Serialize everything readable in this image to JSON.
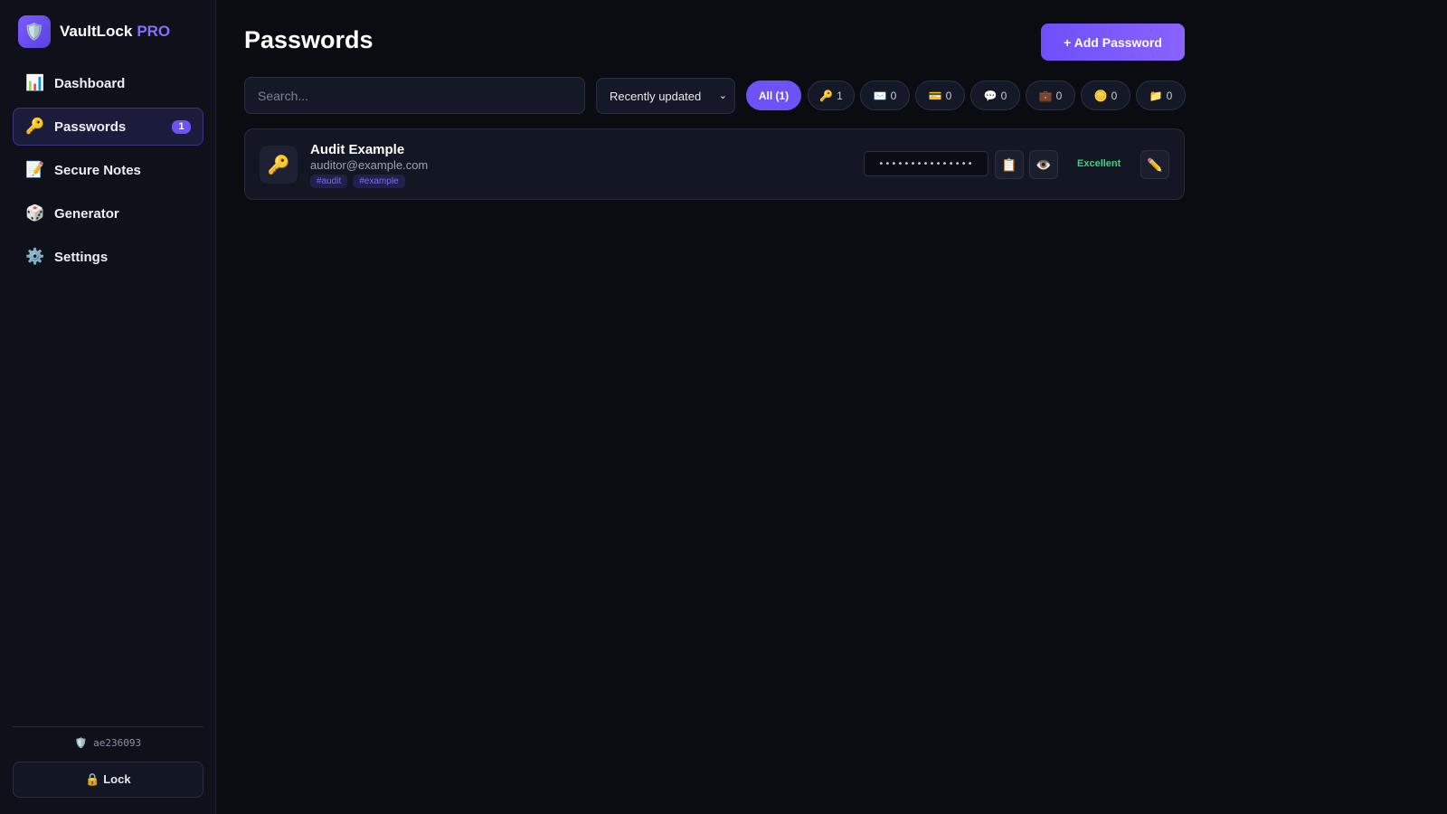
{
  "app": {
    "name": "VaultLock",
    "tier": "PRO",
    "logo_icon": "🛡️"
  },
  "sidebar": {
    "items": [
      {
        "icon": "📊",
        "label": "Dashboard"
      },
      {
        "icon": "🔑",
        "label": "Passwords",
        "badge": "1",
        "active": true
      },
      {
        "icon": "📝",
        "label": "Secure Notes"
      },
      {
        "icon": "🎲",
        "label": "Generator"
      },
      {
        "icon": "⚙️",
        "label": "Settings"
      }
    ],
    "session_id": "ae236093",
    "session_icon": "🛡️",
    "lock_label": "🔒 Lock"
  },
  "main": {
    "title": "Passwords",
    "add_button": "+ Add Password",
    "search": {
      "placeholder": "Search...",
      "value": ""
    },
    "sort": {
      "selected": "Recently updated",
      "chevron": "⌄"
    },
    "filters": [
      {
        "label": "All (1)",
        "active": true
      },
      {
        "icon": "🔑",
        "count": "1"
      },
      {
        "icon": "✉️",
        "count": "0"
      },
      {
        "icon": "💳",
        "count": "0"
      },
      {
        "icon": "💬",
        "count": "0"
      },
      {
        "icon": "💼",
        "count": "0"
      },
      {
        "icon": "🪙",
        "count": "0"
      },
      {
        "icon": "📁",
        "count": "0"
      }
    ],
    "entries": [
      {
        "icon": "🔑",
        "title": "Audit Example",
        "username": "auditor@example.com",
        "tags": [
          "#audit",
          "#example"
        ],
        "masked_password": "•••••••••••••••",
        "copy_icon": "📋",
        "reveal_icon": "👁️",
        "strength": "Excellent",
        "edit_icon": "✏️"
      }
    ]
  },
  "colors": {
    "accent": "#6d52f5",
    "strength_excellent": "#3fd07d",
    "background": "#0b0c12",
    "sidebar": "#0f111a"
  }
}
